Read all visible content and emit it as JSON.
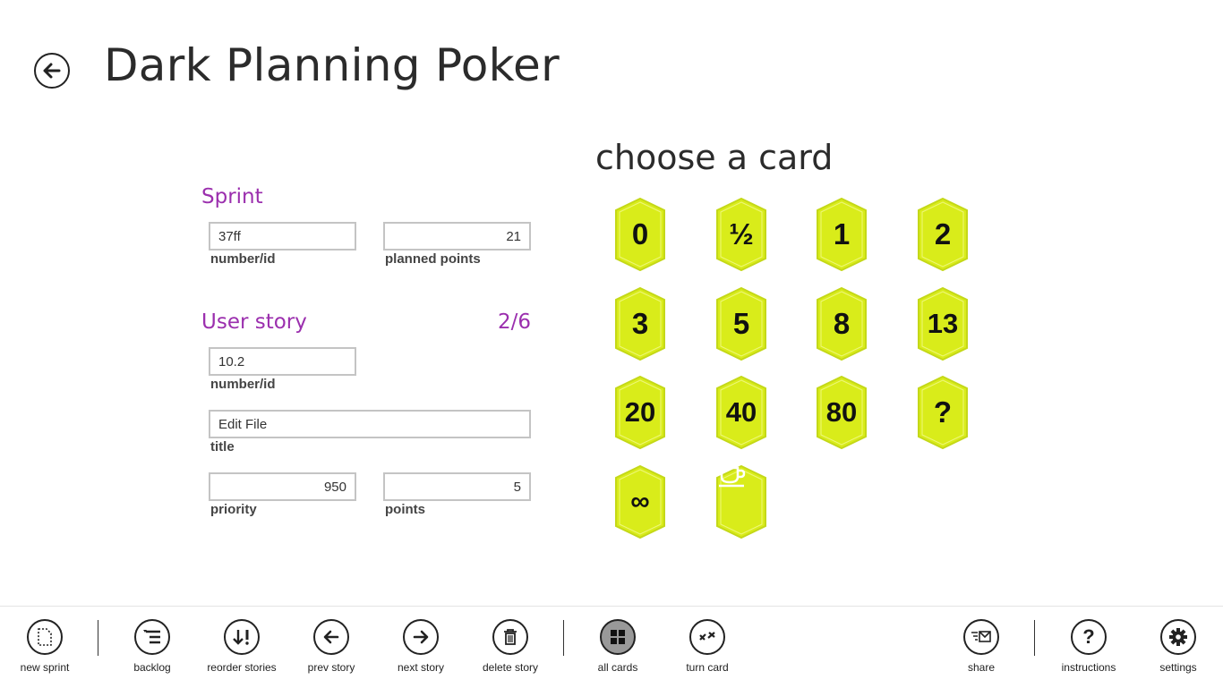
{
  "header": {
    "title": "Dark Planning Poker"
  },
  "sprint": {
    "heading": "Sprint",
    "number_value": "37ff",
    "number_label": "number/id",
    "planned_value": "21",
    "planned_label": "planned points"
  },
  "story": {
    "heading": "User story",
    "counter": "2/6",
    "number_value": "10.2",
    "number_label": "number/id",
    "title_value": "Edit File",
    "title_label": "title",
    "priority_value": "950",
    "priority_label": "priority",
    "points_value": "5",
    "points_label": "points"
  },
  "cards": {
    "heading": "choose a card",
    "color": "#d9ec1a",
    "items": [
      "0",
      "½",
      "1",
      "2",
      "3",
      "5",
      "8",
      "13",
      "20",
      "40",
      "80",
      "?",
      "∞",
      "coffee-cup-icon"
    ]
  },
  "appbar": {
    "new_sprint": "new sprint",
    "backlog": "backlog",
    "reorder": "reorder stories",
    "prev": "prev story",
    "next": "next story",
    "delete": "delete story",
    "all_cards": "all cards",
    "turn_card": "turn card",
    "share": "share",
    "instructions": "instructions",
    "settings": "settings"
  }
}
